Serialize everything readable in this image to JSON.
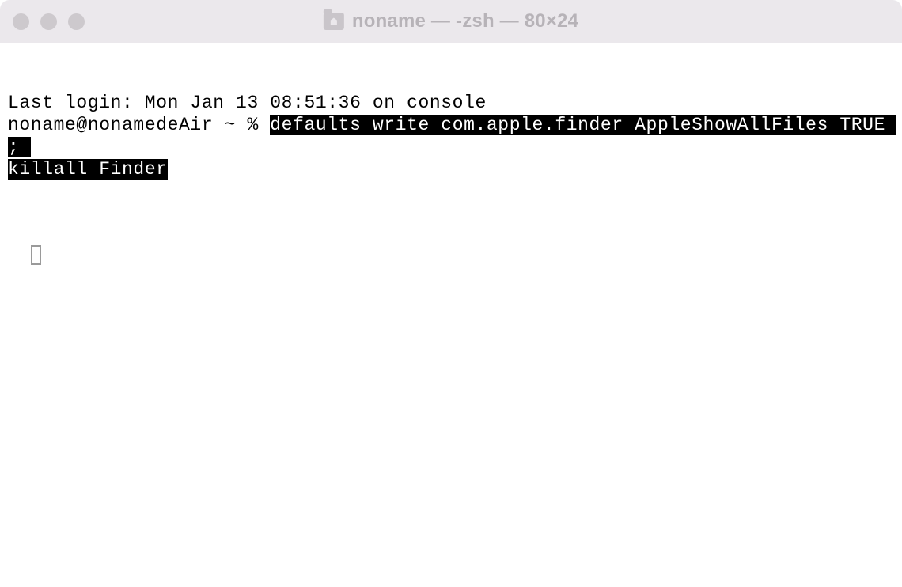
{
  "window": {
    "title": "noname — -zsh — 80×24"
  },
  "terminal": {
    "last_login": "Last login: Mon Jan 13 08:51:36 on console",
    "prompt": "noname@nonamedeAir ~ % ",
    "selected_command_part1": "defaults write com.apple.finder AppleShowAllFiles TRUE ; ",
    "selected_command_part2": "killall Finder"
  }
}
